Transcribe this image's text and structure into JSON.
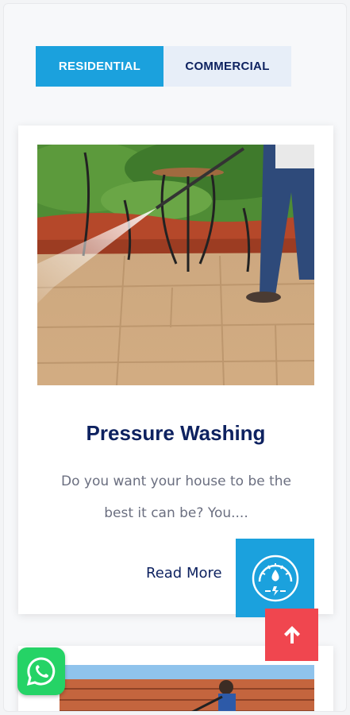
{
  "tabs": [
    {
      "label": "RESIDENTIAL",
      "active": true
    },
    {
      "label": "COMMERCIAL",
      "active": false
    }
  ],
  "service_card": {
    "image_icon": "pressure-washing-photo",
    "title": "Pressure Washing",
    "description": "Do you want your house to be the best it can be? You....",
    "read_more_label": "Read More",
    "icon": "pressure-gauge-icon"
  },
  "next_card": {
    "image_icon": "roof-cleaning-photo"
  },
  "floating": {
    "scroll_top_icon": "arrow-up-icon",
    "whatsapp_icon": "whatsapp-icon"
  },
  "colors": {
    "accent": "#1ba1dd",
    "navy": "#0e2260",
    "scroll_top": "#f0464f",
    "whatsapp": "#25d366"
  }
}
